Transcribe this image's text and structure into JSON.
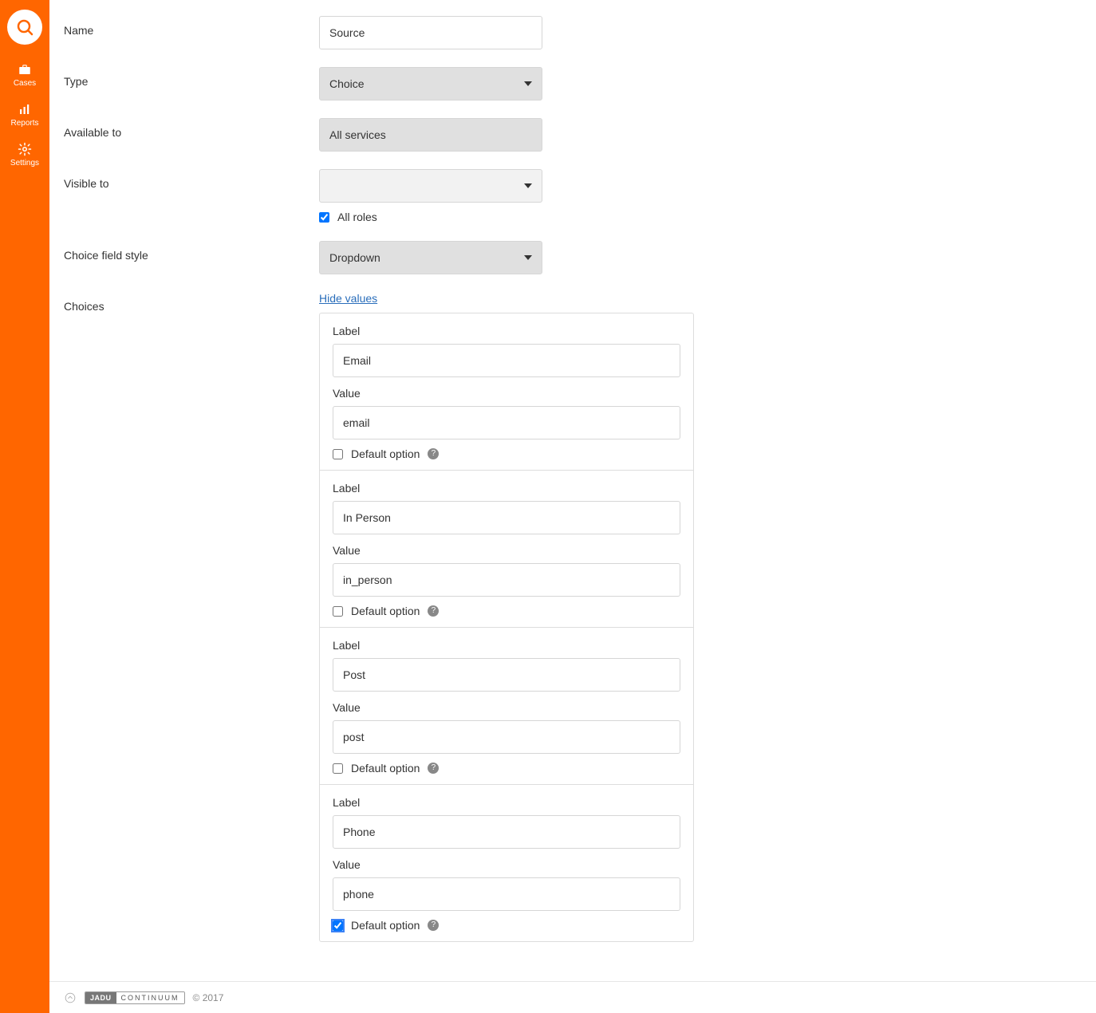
{
  "sidebar": {
    "items": [
      {
        "label": "Cases"
      },
      {
        "label": "Reports"
      },
      {
        "label": "Settings"
      }
    ]
  },
  "form": {
    "name": {
      "label": "Name",
      "value": "Source"
    },
    "type": {
      "label": "Type",
      "value": "Choice"
    },
    "available_to": {
      "label": "Available to",
      "value": "All services"
    },
    "visible_to": {
      "label": "Visible to",
      "value": "",
      "all_roles_label": "All roles",
      "all_roles_checked": true
    },
    "choice_style": {
      "label": "Choice field style",
      "value": "Dropdown"
    },
    "choices": {
      "label": "Choices",
      "toggle_link": "Hide values",
      "sublabel_label": "Label",
      "sublabel_value": "Value",
      "default_option_label": "Default option",
      "items": [
        {
          "label": "Email",
          "value": "email",
          "default": false
        },
        {
          "label": "In Person",
          "value": "in_person",
          "default": false
        },
        {
          "label": "Post",
          "value": "post",
          "default": false
        },
        {
          "label": "Phone",
          "value": "phone",
          "default": true
        }
      ]
    }
  },
  "footer": {
    "brand_a": "JADU",
    "brand_b": "CONTINUUM",
    "copyright": "© 2017"
  }
}
